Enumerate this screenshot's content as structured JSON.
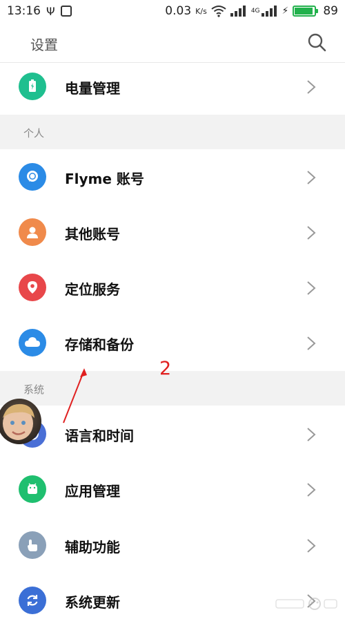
{
  "status_bar": {
    "time": "13:16",
    "speed": "0.03",
    "speed_unit": "K/s",
    "network_badge": "4G",
    "battery": "89"
  },
  "header": {
    "title": "设置"
  },
  "items_top": [
    {
      "label": "电量管理",
      "icon": "battery-icon",
      "color": "#1fbf8f"
    }
  ],
  "section_personal": "个人",
  "items_personal": [
    {
      "label": "Flyme 账号",
      "icon": "flyme-account-icon",
      "color": "#2b8be6"
    },
    {
      "label": "其他账号",
      "icon": "person-icon",
      "color": "#f08a4b"
    },
    {
      "label": "定位服务",
      "icon": "location-pin-icon",
      "color": "#e8474a"
    },
    {
      "label": "存储和备份",
      "icon": "cloud-icon",
      "color": "#2b8be6"
    }
  ],
  "section_system": "系统",
  "items_system": [
    {
      "label": "语言和时间",
      "icon": "globe-icon",
      "color": "#4a6fd6"
    },
    {
      "label": "应用管理",
      "icon": "android-icon",
      "color": "#1fbf6f"
    },
    {
      "label": "辅助功能",
      "icon": "hand-pointer-icon",
      "color": "#8aa0b8"
    },
    {
      "label": "系统更新",
      "icon": "refresh-icon",
      "color": "#3b6fd6"
    }
  ],
  "annotation": {
    "number": "2"
  }
}
